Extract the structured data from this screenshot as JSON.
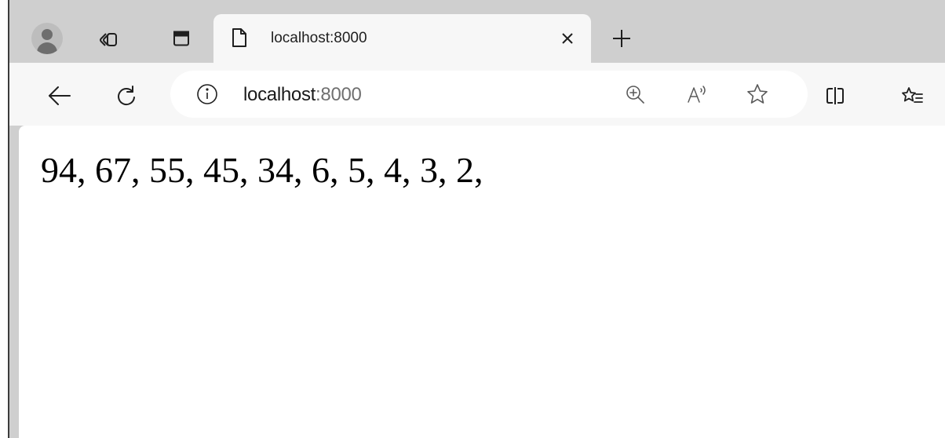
{
  "tab": {
    "title": "localhost:8000",
    "page_icon": "page-icon",
    "close_icon": "close-icon"
  },
  "new_tab_icon": "plus-icon",
  "profile_icon": "avatar-icon",
  "workspaces_icon": "workspaces-icon",
  "tab_actions_icon": "tab-actions-icon",
  "toolbar": {
    "back_icon": "back-arrow-icon",
    "refresh_icon": "refresh-icon",
    "split_screen_icon": "split-screen-icon",
    "favorites_icon": "favorites-icon"
  },
  "address_bar": {
    "info_icon": "info-icon",
    "host": "localhost",
    "port": ":8000",
    "zoom_icon": "zoom-in-icon",
    "read_aloud_icon": "read-aloud-icon",
    "favorite_icon": "star-icon"
  },
  "page": {
    "text": "94, 67, 55, 45, 34, 6, 5, 4, 3, 2,"
  },
  "colors": {
    "chrome_background": "#cfcfcf",
    "active_tab": "#f7f7f7",
    "content_background": "#ffffff",
    "icon": "#1f1f1f",
    "port_text": "#707070"
  }
}
